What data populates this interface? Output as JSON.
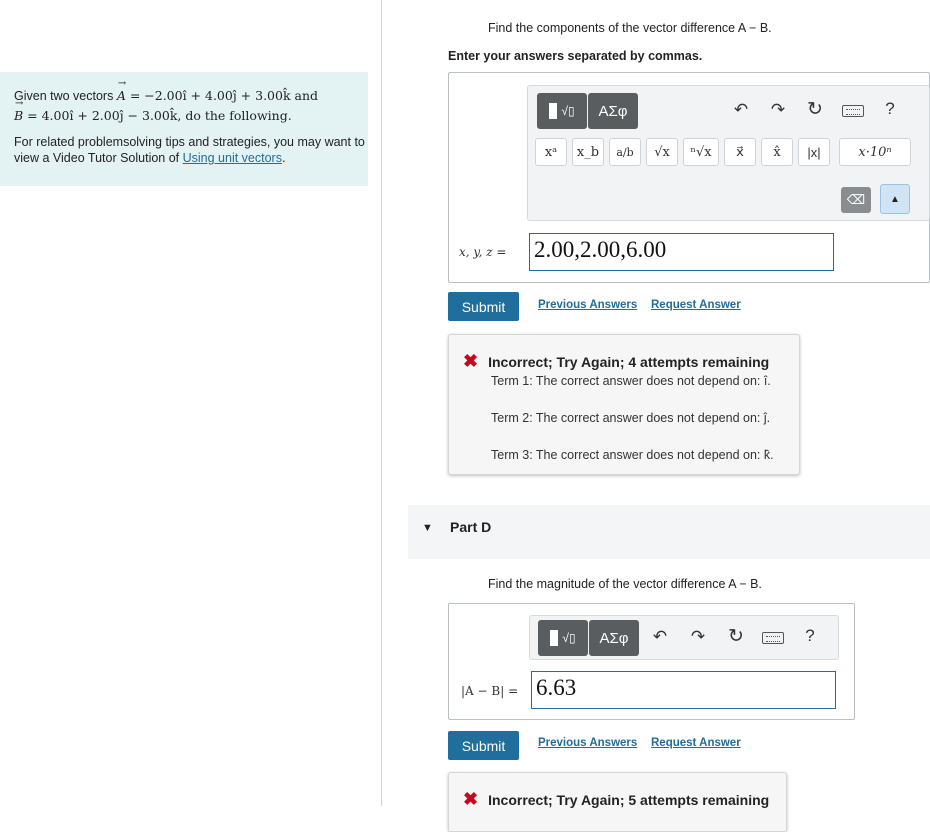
{
  "intro": {
    "line1_prefix": "Given two vectors ",
    "vecA_name": "A",
    "vecA_expr": " = −2.00î + 4.00ĵ + 3.00k̂ and",
    "vecB_name": "B",
    "vecB_expr": " = 4.00î + 2.00ĵ − 3.00k̂, do the following.",
    "tip_text": "For related problemsolving tips and strategies, you may want to view a Video Tutor Solution of ",
    "tip_link": "Using unit vectors",
    "tip_end": "."
  },
  "partC": {
    "prompt": "Find the components of the vector difference A − B.",
    "instruction": "Enter your answers separated by commas.",
    "toolbar": {
      "templates_label": "▮√▯",
      "greek_label": "ΑΣφ",
      "symbols": [
        "xᵃ",
        "x_b",
        "a/b",
        "√x",
        "ⁿ√x",
        "x⃗",
        "x̂",
        "|x|",
        "x·10ⁿ"
      ]
    },
    "field_label": "x, y, z =",
    "field_value": "2.00,2.00,6.00",
    "submit_label": "Submit",
    "prev_answers": "Previous Answers",
    "request_answer": "Request Answer",
    "feedback": {
      "title": "Incorrect; Try Again; 4 attempts remaining",
      "lines": [
        "Term 1: The correct answer does not depend on: î.",
        "Term 2: The correct answer does not depend on: ĵ.",
        "Term 3: The correct answer does not depend on: k̂."
      ]
    }
  },
  "partD": {
    "title": "Part D",
    "prompt": "Find the magnitude of the vector difference A − B.",
    "field_label": "|A − B| =",
    "field_value": "6.63",
    "submit_label": "Submit",
    "prev_answers": "Previous Answers",
    "request_answer": "Request Answer",
    "feedback_title": "Incorrect; Try Again; 5 attempts remaining"
  },
  "colors": {
    "accent": "#1f6e9b",
    "error": "#d0021b",
    "intro_bg": "#e3f2f3"
  }
}
